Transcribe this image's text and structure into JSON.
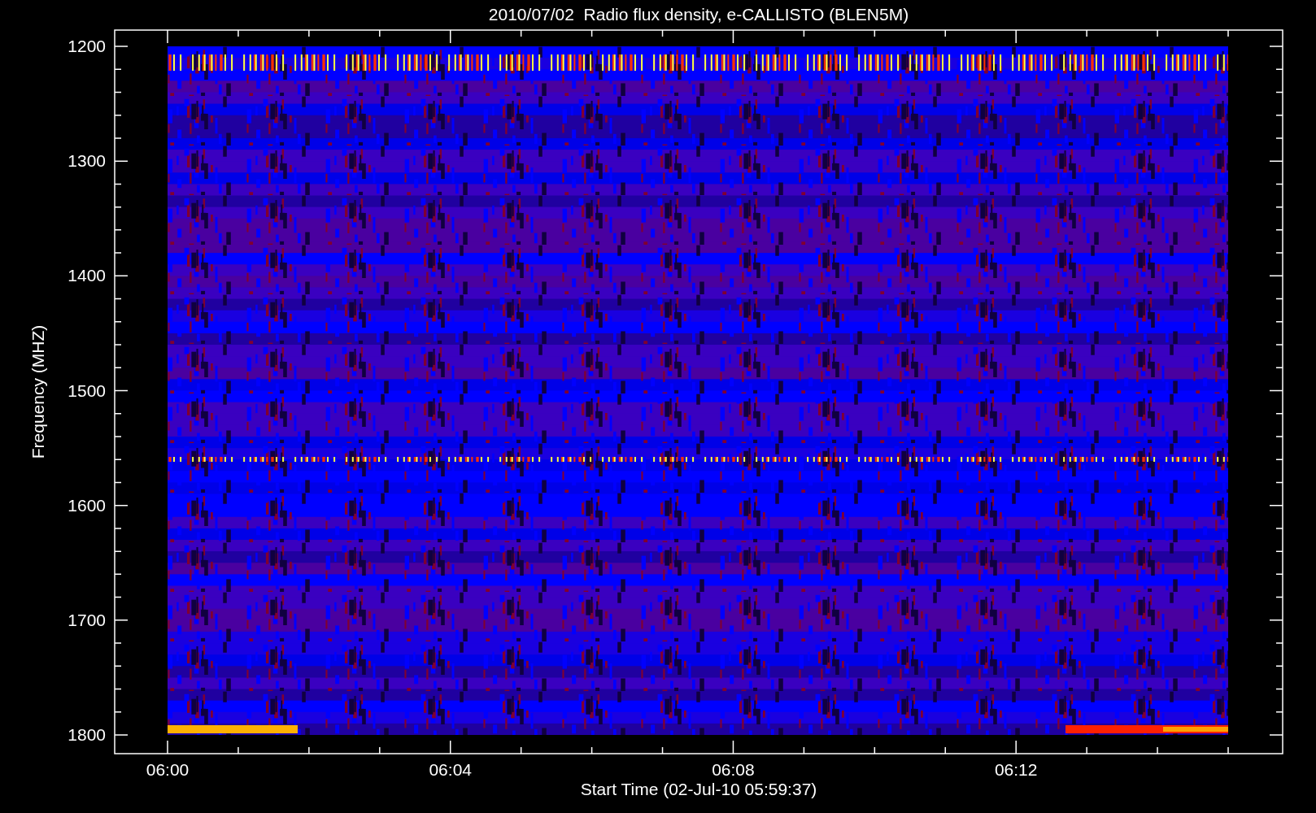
{
  "title": "2010/07/02  Radio flux density, e-CALLISTO (BLEN5M)",
  "y_axis": {
    "label": "Frequency (MHZ)",
    "ticks": [
      "1200",
      "1300",
      "1400",
      "1500",
      "1600",
      "1700",
      "1800"
    ]
  },
  "x_axis": {
    "label": "Start Time (02-Jul-10 05:59:37)",
    "ticks": [
      "06:00",
      "06:04",
      "06:08",
      "06:12"
    ]
  }
}
